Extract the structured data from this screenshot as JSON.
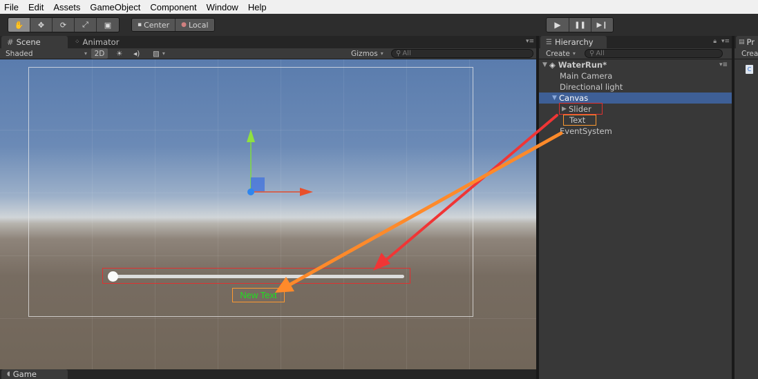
{
  "menu": [
    "File",
    "Edit",
    "Assets",
    "GameObject",
    "Component",
    "Window",
    "Help"
  ],
  "toolbar": {
    "tools": [
      {
        "icon": "hand-icon",
        "glyph": "✋"
      },
      {
        "icon": "move-icon",
        "glyph": "✥"
      },
      {
        "icon": "rotate-icon",
        "glyph": "⟳"
      },
      {
        "icon": "scale-icon",
        "glyph": "⤢"
      },
      {
        "icon": "rect-tool-icon",
        "glyph": "▣"
      }
    ],
    "pivot_label": "Center",
    "space_label": "Local",
    "play_icon": "▶",
    "pause_icon": "❚❚",
    "step_icon": "▶❙"
  },
  "scene": {
    "tab_label": "Scene",
    "animator_tab_label": "Animator",
    "shading_mode": "Shaded",
    "mode_2d": "2D",
    "gizmos_label": "Gizmos",
    "search_placeholder": "All",
    "ui_text": "New Text",
    "slider_value": 0
  },
  "game": {
    "tab_label": "Game"
  },
  "hierarchy": {
    "tab_label": "Hierarchy",
    "create_label": "Create",
    "search_placeholder": "All",
    "scene_name": "WaterRun*",
    "items": [
      {
        "label": "Main Camera"
      },
      {
        "label": "Directional light"
      },
      {
        "label": "Canvas"
      },
      {
        "label": "Slider"
      },
      {
        "label": "Text"
      },
      {
        "label": "EventSystem"
      }
    ]
  },
  "project": {
    "tab_label": "Pr",
    "create_label": "Crea"
  },
  "colors": {
    "selection": "#3e5f96",
    "annotation_red": "#e03030",
    "annotation_orange": "#ff9a30",
    "ui_text_green": "#20e020"
  }
}
